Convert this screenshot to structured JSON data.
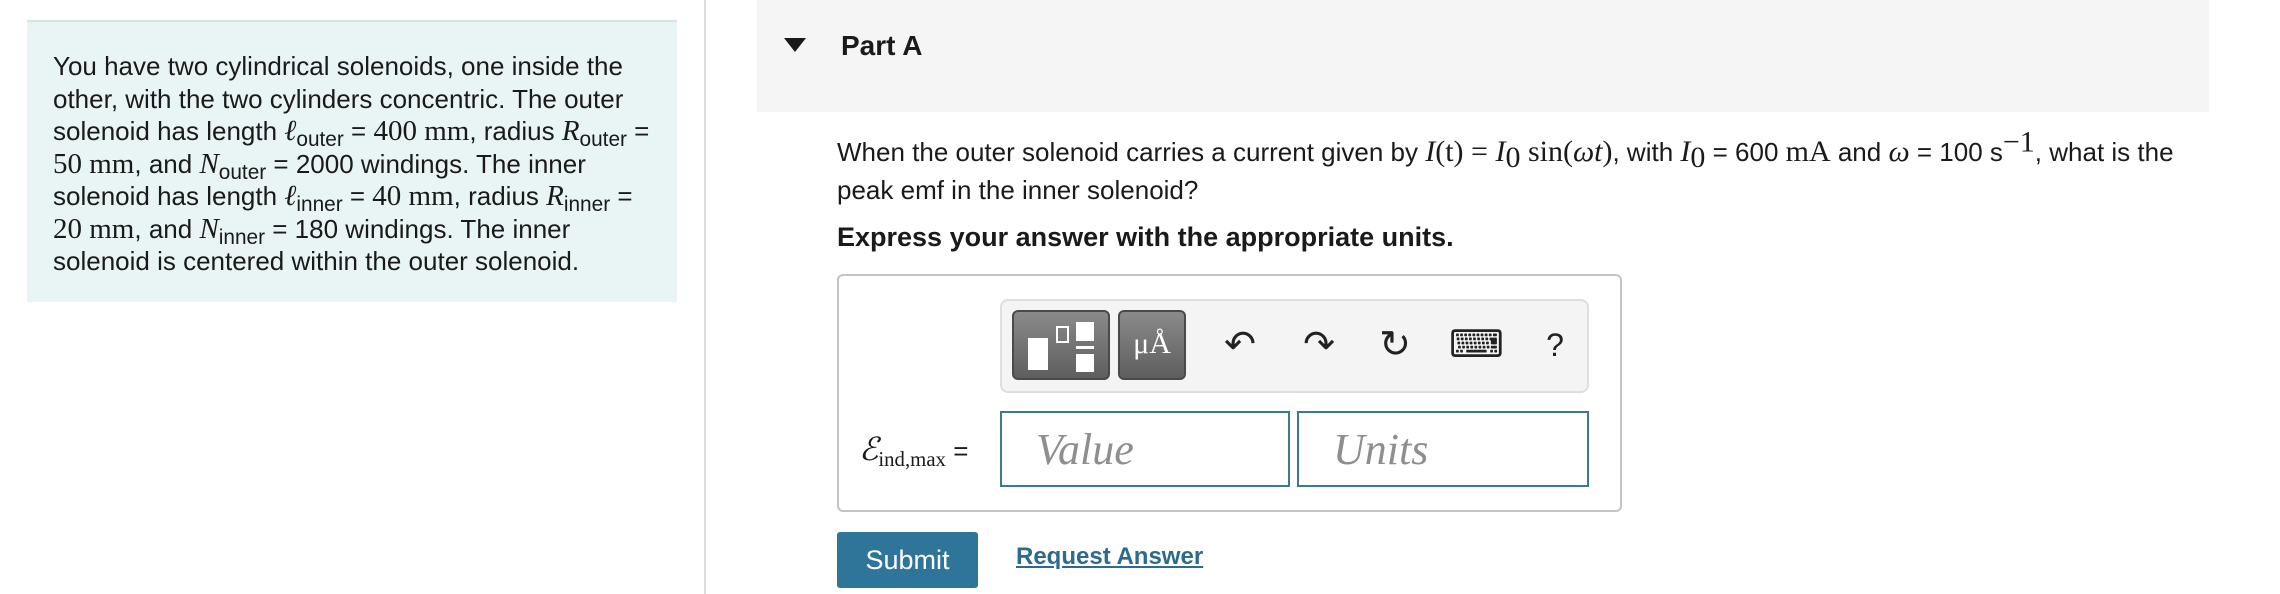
{
  "problem": {
    "t1": "You have two cylindrical solenoids, one inside the other, with the two cylinders concentric. The outer solenoid has length ",
    "sym_l": "ℓ",
    "sub_outer": "outer",
    "eq": " = ",
    "val_l_outer": "400 mm",
    "t2": ", radius ",
    "sym_R": "R",
    "val_R_outer": "50 mm",
    "t3": ", and ",
    "sym_N": "N",
    "val_N_outer": "2000",
    "t4": " windings. The inner solenoid has length ",
    "sub_inner": "inner",
    "val_l_inner": "40 mm",
    "val_R_inner": "20 mm",
    "val_N_inner": "180",
    "t5": " windings. The inner solenoid is centered within the outer solenoid."
  },
  "part": {
    "title": "Part A"
  },
  "question": {
    "q1": "When the outer solenoid carries a current given by ",
    "it": "I",
    "paren_t": "(t) = ",
    "i0": "I",
    "sub0": "0",
    "sin": " sin(",
    "wt": "ωt",
    "close": ")",
    "q2": ", with ",
    "q3": " = 600 ",
    "ma": "mA",
    "q4": " and ",
    "omega": "ω",
    "q5": " = 100 s",
    "sup": "−1",
    "q6": ", what is the peak emf in the inner solenoid?"
  },
  "instruction": "Express your answer with the appropriate units.",
  "toolbar": {
    "units_label": "μÅ",
    "undo_glyph": "↶",
    "redo_glyph": "↷",
    "reset_glyph": "↻",
    "keyboard_glyph": "⌨",
    "help_label": "?"
  },
  "answer": {
    "emf_symbol": "ℰ",
    "emf_sub": "ind,max",
    "equals": " =",
    "value_placeholder": "Value",
    "units_placeholder": "Units"
  },
  "actions": {
    "submit_label": "Submit",
    "request_label": "Request Answer"
  }
}
